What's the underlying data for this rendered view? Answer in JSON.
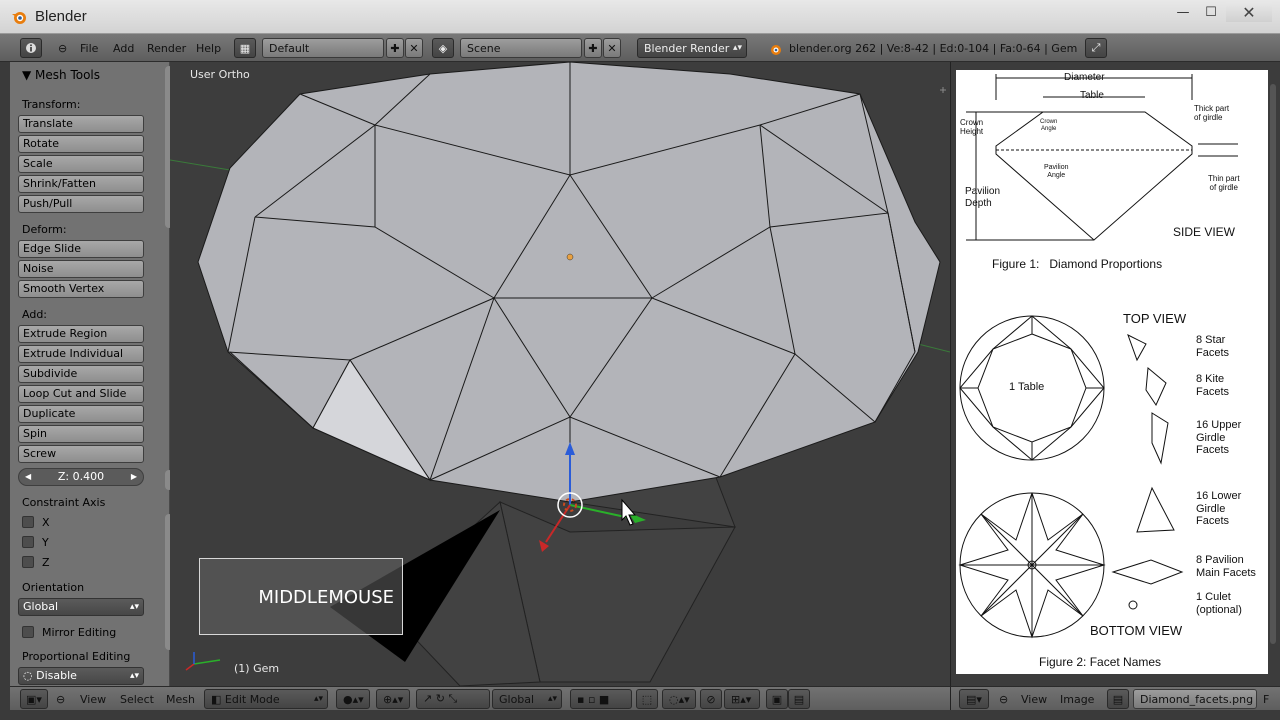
{
  "window": {
    "title": "Blender",
    "min_glyph": "—",
    "max_glyph": "☐",
    "close_glyph": "✕"
  },
  "info_header": {
    "menus": [
      "File",
      "Add",
      "Render",
      "Help"
    ],
    "screen_layout": "Default",
    "scene": "Scene",
    "render_engine": "Blender Render",
    "stats": "blender.org 262 | Ve:8-42 | Ed:0-104 | Fa:0-64 | Gem"
  },
  "tool_shelf": {
    "panel_title": "Mesh Tools",
    "sections": {
      "transform": "Transform:",
      "deform": "Deform:",
      "add": "Add:"
    },
    "transform_buttons": [
      "Translate",
      "Rotate",
      "Scale",
      "Shrink/Fatten",
      "Push/Pull"
    ],
    "deform_buttons": [
      "Edge Slide",
      "Noise",
      "Smooth Vertex"
    ],
    "add_buttons": [
      "Extrude Region",
      "Extrude Individual",
      "Subdivide",
      "Loop Cut and Slide",
      "Duplicate",
      "Spin",
      "Screw"
    ],
    "z_value": "Z: 0.400",
    "constraint_axis_label": "Constraint Axis",
    "axes": [
      "X",
      "Y",
      "Z"
    ],
    "orientation_label": "Orientation",
    "orientation_value": "Global",
    "mirror_editing": "Mirror Editing",
    "proportional_label": "Proportional Editing",
    "proportional_value": "Disable"
  },
  "viewport": {
    "view_label": "User Ortho",
    "object_label": "(1) Gem",
    "key_overlay": "MIDDLEMOUSE"
  },
  "view3d_header": {
    "menus": [
      "View",
      "Select",
      "Mesh"
    ],
    "mode": "Edit Mode",
    "orientation": "Global"
  },
  "image_editor_header": {
    "menus": [
      "View",
      "Image"
    ],
    "image_name": "Diamond_facets.png",
    "trailing": "F"
  },
  "diagram": {
    "diameter": "Diameter",
    "table": "Table",
    "crown_height": "Crown\nHeight",
    "crown_angle": "Crown\nAngle",
    "thick_girdle": "Thick part\nof girdle",
    "pavilion_angle": "Pavilion\nAngle",
    "thin_girdle": "Thin part\nof girdle",
    "pavilion_depth": "Pavilion\nDepth",
    "side_view": "SIDE VIEW",
    "figure1": "Figure 1:   Diamond Proportions",
    "top_view": "TOP VIEW",
    "table_facet": "1 Table",
    "star": "8 Star\nFacets",
    "kite": "8 Kite\nFacets",
    "upper_girdle": "16 Upper\nGirdle\nFacets",
    "lower_girdle": "16 Lower\nGirdle\nFacets",
    "pavilion_main": "8 Pavilion\nMain Facets",
    "culet": "1 Culet\n(optional)",
    "bottom_view": "BOTTOM VIEW",
    "figure2": "Figure 2: Facet Names"
  },
  "colors": {
    "panel_bg": "#727272",
    "viewport_bg": "#3d3d3d",
    "mesh_face": "#b4b4b8",
    "header_bg": "#6a6a6a",
    "select_orange": "#e8a040"
  }
}
